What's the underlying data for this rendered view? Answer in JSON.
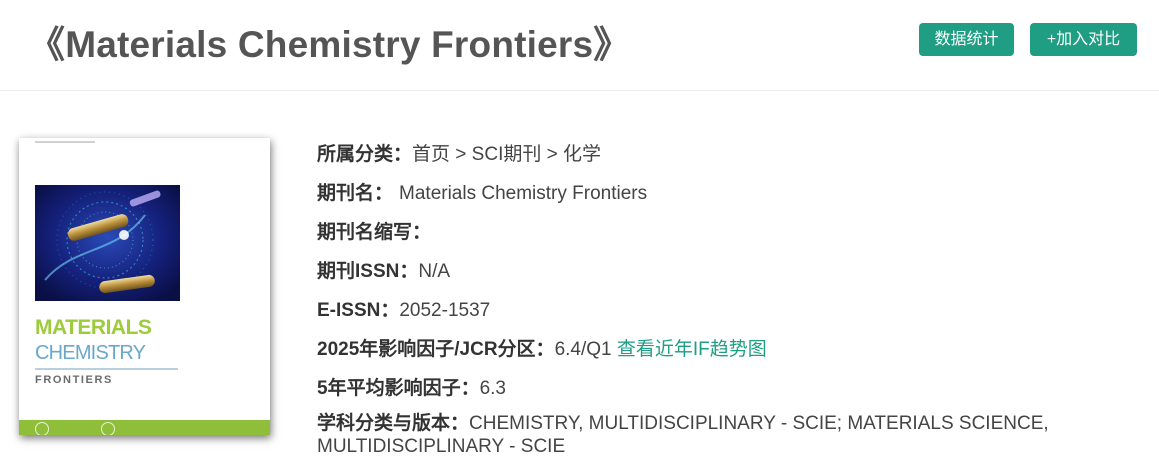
{
  "header": {
    "title": "《Materials Chemistry Frontiers》",
    "buttons": {
      "stats": "数据统计",
      "compare": "+加入对比"
    }
  },
  "cover": {
    "line1": "MATERIALS",
    "line2": "CHEMISTRY",
    "line3": "FRONTIERS",
    "colors": {
      "materials": "#9ccb3b",
      "chemistry": "#69a8c9",
      "band": "#8fbf3a"
    }
  },
  "info": {
    "category_label": "所属分类：",
    "category_value": "首页 > SCI期刊 > 化学",
    "name_label": "期刊名：",
    "name_value": "Materials Chemistry Frontiers",
    "abbr_label": "期刊名缩写：",
    "abbr_value": "",
    "issn_label": "期刊ISSN：",
    "issn_value": "N/A",
    "eissn_label": "E-ISSN：",
    "eissn_value": "2052-1537",
    "if_label": "2025年影响因子/JCR分区：",
    "if_value": "6.4/Q1",
    "if_trend_link": "查看近年IF趋势图",
    "avg_if_label": "5年平均影响因子：",
    "avg_if_value": "6.3",
    "subject_label": "学科分类与版本：",
    "subject_value": "CHEMISTRY, MULTIDISCIPLINARY - SCIE; MATERIALS SCIENCE, MULTIDISCIPLINARY - SCIE"
  },
  "colors": {
    "accent": "#1f9e83",
    "text": "#444444"
  }
}
